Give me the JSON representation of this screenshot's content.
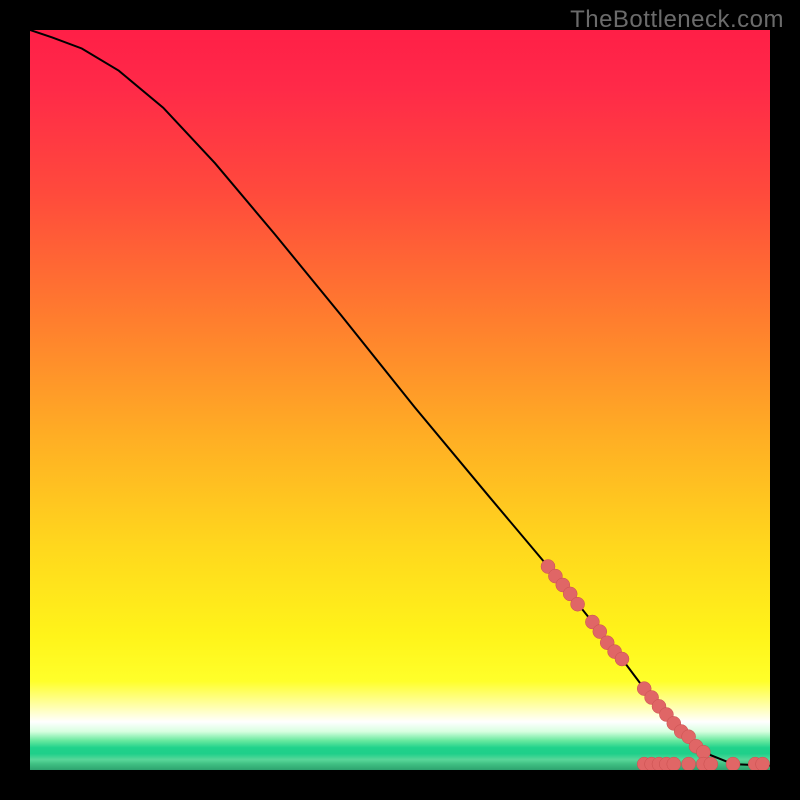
{
  "watermark": "TheBottleneck.com",
  "chart_data": {
    "type": "line",
    "title": "",
    "xlabel": "",
    "ylabel": "",
    "xlim": [
      0,
      100
    ],
    "ylim": [
      0,
      100
    ],
    "grid": false,
    "series": [
      {
        "name": "curve",
        "x": [
          0,
          3,
          7,
          12,
          18,
          25,
          33,
          42,
          52,
          62,
          70,
          76,
          80,
          83,
          86,
          89,
          92,
          95,
          100
        ],
        "y": [
          100,
          99,
          97.5,
          94.5,
          89.5,
          82,
          72.5,
          61.5,
          49,
          37,
          27.5,
          20,
          15,
          11,
          7.5,
          4.5,
          2,
          0.8,
          0.6
        ]
      }
    ],
    "markers": {
      "name": "highlighted-points",
      "color": "#e06666",
      "points_xy": [
        [
          70,
          27.5
        ],
        [
          71,
          26.2
        ],
        [
          72,
          25.0
        ],
        [
          73,
          23.8
        ],
        [
          74,
          22.4
        ],
        [
          76,
          20.0
        ],
        [
          77,
          18.7
        ],
        [
          78,
          17.2
        ],
        [
          79,
          16.0
        ],
        [
          80,
          15.0
        ],
        [
          83,
          11.0
        ],
        [
          84,
          9.8
        ],
        [
          85,
          8.6
        ],
        [
          86,
          7.5
        ],
        [
          87,
          6.3
        ],
        [
          88,
          5.2
        ],
        [
          89,
          4.5
        ],
        [
          90,
          3.2
        ],
        [
          91,
          2.4
        ],
        [
          83,
          0.8
        ],
        [
          84,
          0.8
        ],
        [
          85,
          0.8
        ],
        [
          86,
          0.8
        ],
        [
          87,
          0.8
        ],
        [
          89,
          0.8
        ],
        [
          91,
          0.8
        ],
        [
          92,
          0.8
        ],
        [
          95,
          0.8
        ],
        [
          98,
          0.8
        ],
        [
          99,
          0.8
        ]
      ]
    },
    "background": {
      "type": "vertical-gradient",
      "stops": [
        {
          "pos": 0.0,
          "color": "#ff1f47"
        },
        {
          "pos": 0.55,
          "color": "#ffd81d"
        },
        {
          "pos": 0.88,
          "color": "#ffff2a"
        },
        {
          "pos": 0.935,
          "color": "#ffffff"
        },
        {
          "pos": 0.97,
          "color": "#20d28b"
        },
        {
          "pos": 1.0,
          "color": "#2ea36f"
        }
      ]
    }
  }
}
